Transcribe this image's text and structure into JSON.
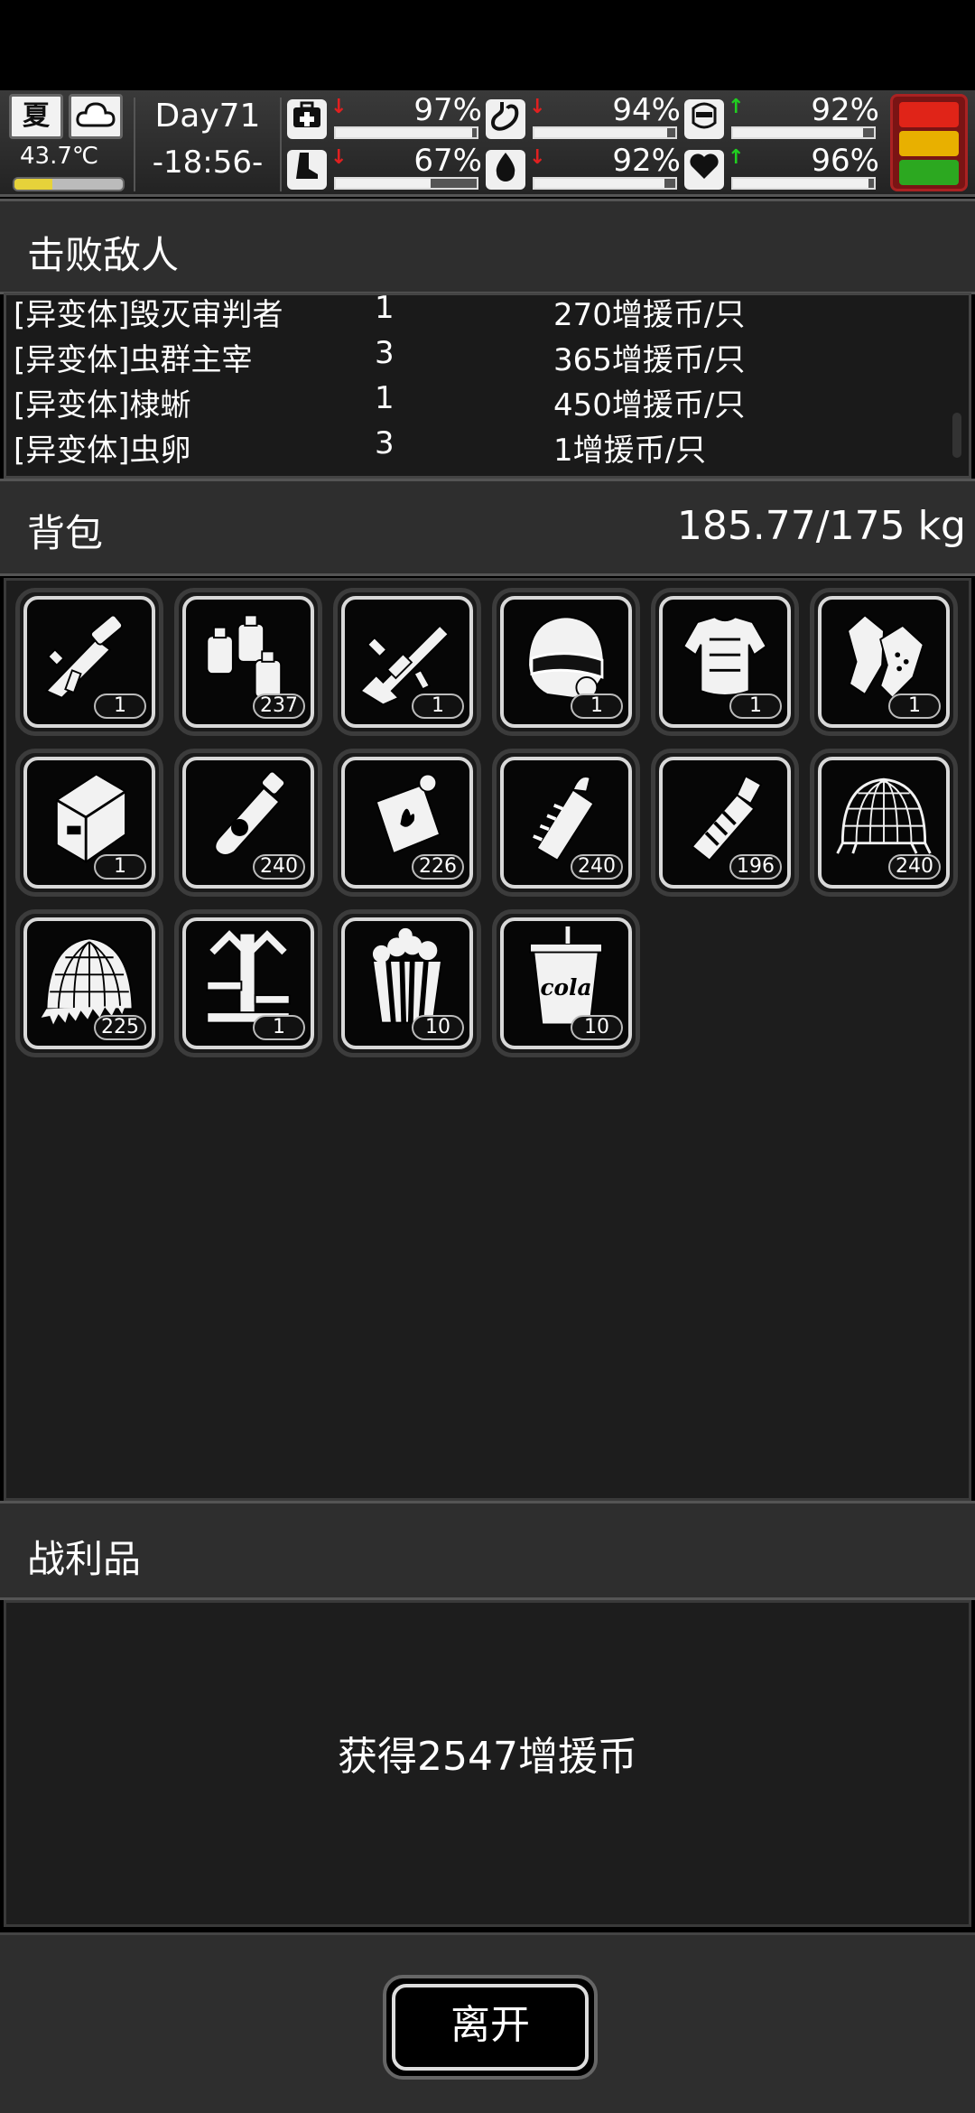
{
  "hud": {
    "season": "夏",
    "weather_icon": "cloud-icon",
    "temperature": "43.7℃",
    "temperature_level": 0.35,
    "day": "Day71",
    "time": "-18:56-",
    "stats": [
      {
        "name": "health",
        "icon": "medkit-icon",
        "trend": "down",
        "value": "97%",
        "level": 0.97
      },
      {
        "name": "hunger",
        "icon": "stomach-icon",
        "trend": "down",
        "value": "94%",
        "level": 0.94
      },
      {
        "name": "mood",
        "icon": "mask-icon",
        "trend": "up",
        "value": "92%",
        "level": 0.92
      },
      {
        "name": "stamina",
        "icon": "boot-icon",
        "trend": "down",
        "value": "67%",
        "level": 0.67
      },
      {
        "name": "thirst",
        "icon": "water-drop-icon",
        "trend": "down",
        "value": "92%",
        "level": 0.92
      },
      {
        "name": "heart",
        "icon": "heart-icon",
        "trend": "up",
        "value": "96%",
        "level": 0.96
      }
    ],
    "alert_colors": [
      "#e02418",
      "#e8b000",
      "#2ca820"
    ]
  },
  "defeated": {
    "title": "击败敌人",
    "rows": [
      {
        "name": "[异变体]毁灭审判者",
        "count": "1",
        "reward": "270增援币/只"
      },
      {
        "name": "[异变体]虫群主宰",
        "count": "3",
        "reward": "365增援币/只"
      },
      {
        "name": "[异变体]棣蜥",
        "count": "1",
        "reward": "450增援币/只"
      },
      {
        "name": "[异变体]虫卵",
        "count": "3",
        "reward": "1增援币/只"
      }
    ]
  },
  "backpack": {
    "title": "背包",
    "weight": "185.77/175 kg",
    "items": [
      {
        "icon": "flamethrower-icon",
        "qty": "1"
      },
      {
        "icon": "fuel-canisters-icon",
        "qty": "237"
      },
      {
        "icon": "assault-rifle-icon",
        "qty": "1"
      },
      {
        "icon": "combat-helmet-icon",
        "qty": "1"
      },
      {
        "icon": "body-armor-icon",
        "qty": "1"
      },
      {
        "icon": "tactical-gloves-icon",
        "qty": "1"
      },
      {
        "icon": "armored-case-icon",
        "qty": "1"
      },
      {
        "icon": "toxic-spray-icon",
        "qty": "240"
      },
      {
        "icon": "incendiary-grenade-icon",
        "qty": "226"
      },
      {
        "icon": "spiked-grenade-icon",
        "qty": "240"
      },
      {
        "icon": "frag-grenade-icon",
        "qty": "196"
      },
      {
        "icon": "wire-net-icon",
        "qty": "240"
      },
      {
        "icon": "spiked-shell-icon",
        "qty": "225"
      },
      {
        "icon": "mech-legs-icon",
        "qty": "1"
      },
      {
        "icon": "popcorn-icon",
        "qty": "10"
      },
      {
        "icon": "cola-cup-icon",
        "qty": "10",
        "label": "cola"
      }
    ]
  },
  "loot": {
    "title": "战利品",
    "message": "获得2547增援币"
  },
  "footer": {
    "leave_label": "离开"
  }
}
